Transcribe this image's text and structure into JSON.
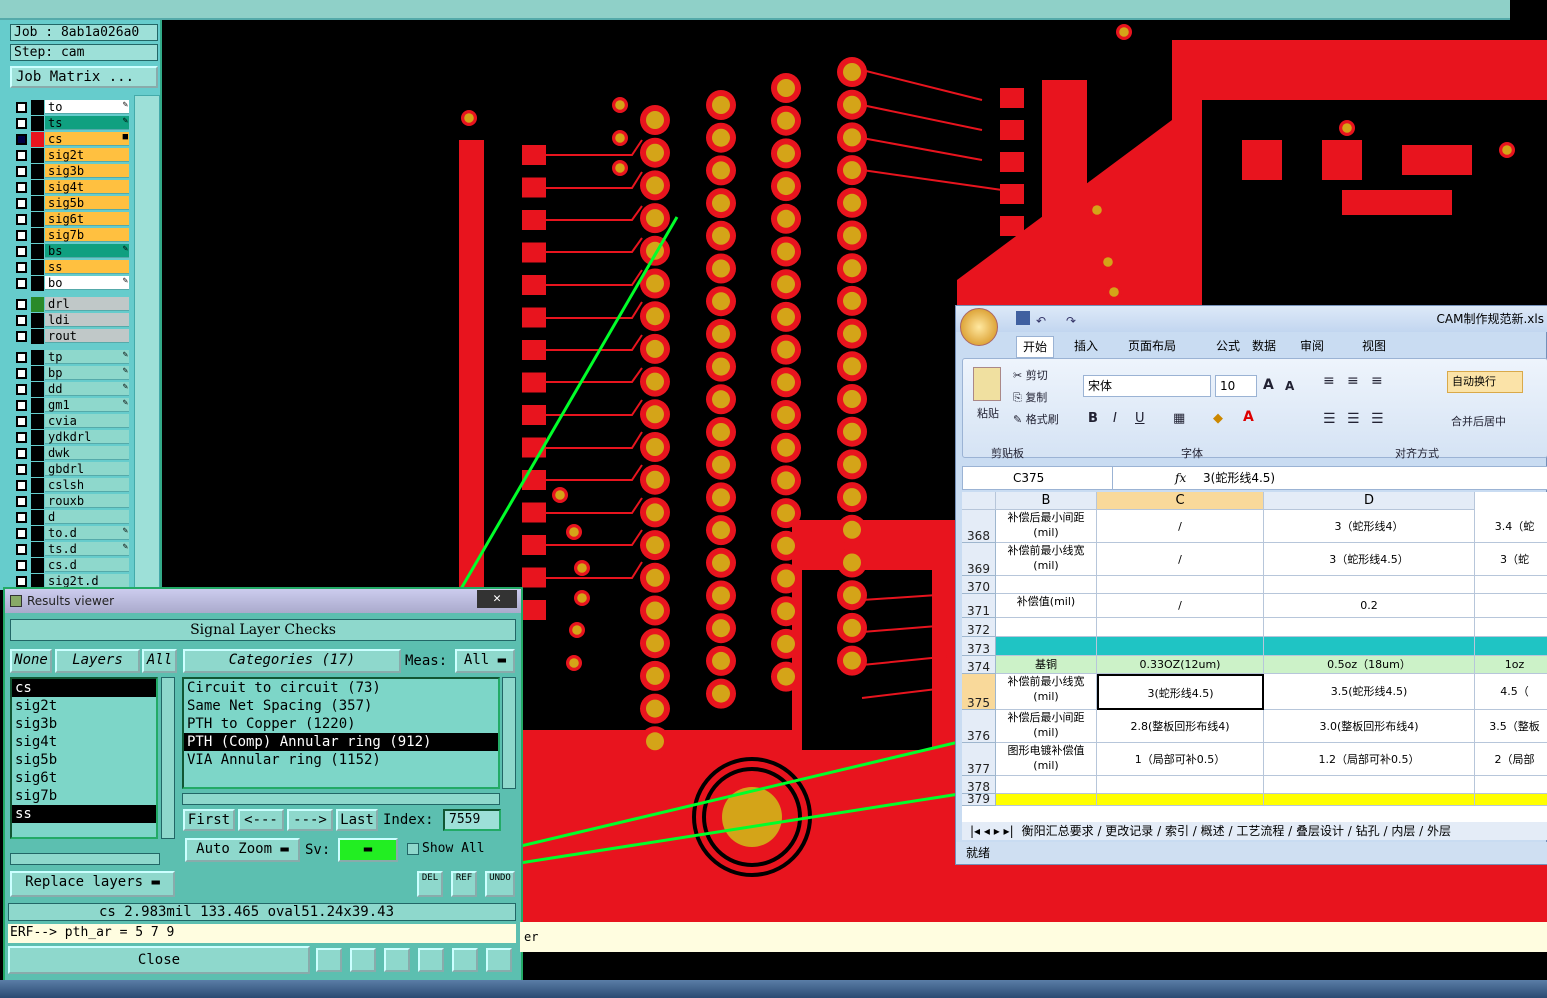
{
  "job": {
    "job_line": "Job : 8ab1a026a0",
    "step_line": "Step: cam",
    "matrix_button": "Job Matrix ..."
  },
  "layers": [
    {
      "name": "to",
      "color": "#ffffff",
      "mark": "✎"
    },
    {
      "name": "ts",
      "color": "#10a080",
      "mark": "✎"
    },
    {
      "name": "cs",
      "color": "#ffc040",
      "mark": "■",
      "active": true
    },
    {
      "name": "sig2t",
      "color": "#ffc040",
      "mark": ""
    },
    {
      "name": "sig3b",
      "color": "#ffc040",
      "mark": ""
    },
    {
      "name": "sig4t",
      "color": "#ffc040",
      "mark": ""
    },
    {
      "name": "sig5b",
      "color": "#ffc040",
      "mark": ""
    },
    {
      "name": "sig6t",
      "color": "#ffc040",
      "mark": ""
    },
    {
      "name": "sig7b",
      "color": "#ffc040",
      "mark": ""
    },
    {
      "name": "bs",
      "color": "#10a080",
      "mark": "✎"
    },
    {
      "name": "ss",
      "color": "#ffc040",
      "mark": ""
    },
    {
      "name": "bo",
      "color": "#ffffff",
      "mark": "✎"
    },
    {
      "name": "drl",
      "color": "#c0c8c8",
      "mark": ""
    },
    {
      "name": "ldi",
      "color": "#c0c8c8",
      "mark": ""
    },
    {
      "name": "rout",
      "color": "#c0c8c8",
      "mark": ""
    },
    {
      "name": "tp",
      "color": "#8ed8cc",
      "mark": "✎"
    },
    {
      "name": "bp",
      "color": "#8ed8cc",
      "mark": "✎"
    },
    {
      "name": "dd",
      "color": "#8ed8cc",
      "mark": "✎"
    },
    {
      "name": "gm1",
      "color": "#8ed8cc",
      "mark": "✎"
    },
    {
      "name": "cvia",
      "color": "#8ed8cc",
      "mark": ""
    },
    {
      "name": "ydkdrl",
      "color": "#8ed8cc",
      "mark": ""
    },
    {
      "name": "dwk",
      "color": "#8ed8cc",
      "mark": ""
    },
    {
      "name": "gbdrl",
      "color": "#8ed8cc",
      "mark": ""
    },
    {
      "name": "cslsh",
      "color": "#8ed8cc",
      "mark": ""
    },
    {
      "name": "rouxb",
      "color": "#8ed8cc",
      "mark": ""
    },
    {
      "name": "d",
      "color": "#8ed8cc",
      "mark": ""
    },
    {
      "name": "to.d",
      "color": "#8ed8cc",
      "mark": "✎"
    },
    {
      "name": "ts.d",
      "color": "#8ed8cc",
      "mark": "✎"
    },
    {
      "name": "cs.d",
      "color": "#8ed8cc",
      "mark": ""
    },
    {
      "name": "sig2t.d",
      "color": "#8ed8cc",
      "mark": ""
    }
  ],
  "results": {
    "window_title": "Results viewer",
    "close_x": "✕",
    "header": "Signal Layer Checks",
    "none_btn": "None",
    "layers_btn": "Layers",
    "all_btn": "All",
    "categories_btn": "Categories (17)",
    "meas_label": "Meas:",
    "meas_value": "All",
    "layer_list": [
      "cs",
      "sig2t",
      "sig3b",
      "sig4t",
      "sig5b",
      "sig6t",
      "sig7b",
      "ss"
    ],
    "categories": [
      "Circuit to circuit (73)",
      "Same Net Spacing (357)",
      "PTH to Copper (1220)",
      "PTH (Comp) Annular ring (912)",
      "VIA Annular ring (1152)"
    ],
    "first": "First",
    "prev": "<---",
    "next": "--->",
    "last": "Last",
    "index_label": "Index:",
    "index_value": "7559",
    "auto_zoom": "Auto Zoom",
    "sv_label": "Sv:",
    "show_all": "Show All",
    "replace_layers": "Replace layers",
    "del": "DEL",
    "ref": "REF",
    "undo": "UNDO",
    "status": "cs 2.983mil  133.465  oval51.24x39.43",
    "erf": "ERF--> pth_ar = 5 7 9",
    "close": "Close"
  },
  "hint_text": "er",
  "excel": {
    "title": "CAM制作规范新.xls",
    "tabs": [
      "开始",
      "插入",
      "页面布局",
      "公式",
      "数据",
      "审阅",
      "视图"
    ],
    "paste": "粘贴",
    "cut": "剪切",
    "copy": "复制",
    "format_painter": "格式刷",
    "font_name": "宋体",
    "font_size": "10",
    "group_clipboard": "剪贴板",
    "group_font": "字体",
    "group_align": "对齐方式",
    "wrap": "自动换行",
    "merge": "合并后居中",
    "cell_ref": "C375",
    "fx": "fx",
    "formula": "3(蛇形线4.5)",
    "col_headers": [
      "B",
      "C",
      "D"
    ],
    "rows": [
      {
        "num": "368",
        "b": "补偿后最小间距(mil)",
        "c": "/",
        "d": "3（蛇形线4）",
        "e": "3.4（蛇"
      },
      {
        "num": "369",
        "b": "补偿前最小线宽(mil)",
        "c": "/",
        "d": "3（蛇形线4.5）",
        "e": "3（蛇"
      },
      {
        "num": "370",
        "b": "",
        "c": "",
        "d": "",
        "e": ""
      },
      {
        "num": "371",
        "b": "补偿值(mil)",
        "c": "/",
        "d": "0.2",
        "e": ""
      },
      {
        "num": "372",
        "b": "",
        "c": "",
        "d": "",
        "e": ""
      },
      {
        "num": "373",
        "b": "",
        "c": "",
        "d": "",
        "e": ""
      },
      {
        "num": "374",
        "b": "基铜",
        "c": "0.33OZ(12um)",
        "d": "0.5oz（18um）",
        "e": "1oz"
      },
      {
        "num": "375",
        "b": "补偿前最小线宽(mil)",
        "c": "3(蛇形线4.5)",
        "d": "3.5(蛇形线4.5)",
        "e": "4.5（"
      },
      {
        "num": "376",
        "b": "补偿后最小间距(mil)",
        "c": "2.8(整板回形布线4)",
        "d": "3.0(整板回形布线4)",
        "e": "3.5（整板"
      },
      {
        "num": "377",
        "b": "图形电镀补偿值(mil)",
        "c": "1（局部可补0.5）",
        "d": "1.2（局部可补0.5）",
        "e": "2（局部"
      },
      {
        "num": "378",
        "b": "",
        "c": "",
        "d": "",
        "e": ""
      },
      {
        "num": "379",
        "b": "",
        "c": "",
        "d": "",
        "e": ""
      }
    ],
    "sheet_tabs": "衡阳汇总要求 / 更改记录 / 索引 / 概述 / 工艺流程 / 叠层设计 / 钻孔 / 内层 / 外层",
    "status": "就绪"
  }
}
